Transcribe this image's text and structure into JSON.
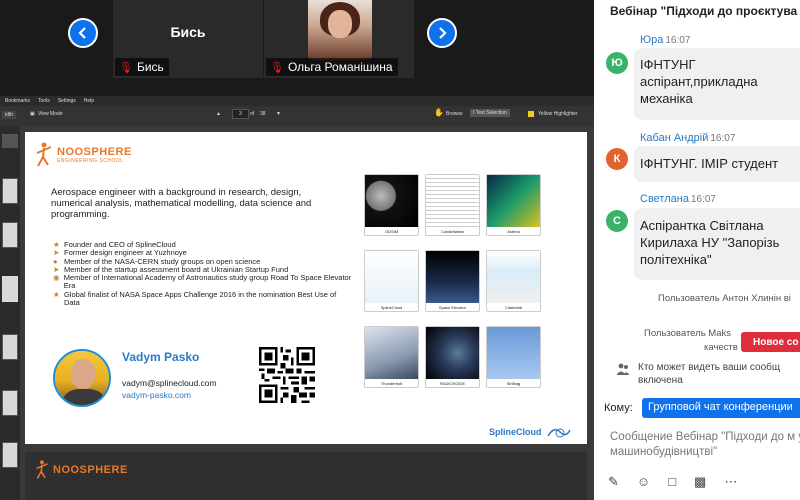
{
  "participants": [
    {
      "name": "Бись",
      "tile_text": "Бись"
    },
    {
      "name": "Ольга Романішина"
    }
  ],
  "pdf_viewer": {
    "menu": [
      "Bookmarks",
      "Tools",
      "Settings",
      "Help"
    ],
    "zoom_label": "idth",
    "view_mode": "View Mode",
    "page_current": "3",
    "page_of": "of",
    "page_total": "38",
    "browse": "Browse",
    "text_selection": "Text Selection",
    "highlighter": "Yellow Highlighter"
  },
  "slide": {
    "logo_name": "NOOSPHERE",
    "logo_sub": "ENGINEERING SCHOOL",
    "description": "Aerospace engineer with a background in research, design, numerical analysis, mathematical modelling, data science and programming.",
    "bullets": [
      "Founder and CEO of SplineCloud",
      "Former design engineer at Yuzhnoye",
      "Member of the NASA-CERN study groups on open science",
      "Member of the startup assessment board at Ukrainian Startup Fund",
      "Member of International Academy of Astronautics study group Road To Space Elevator Era",
      "Global finalist of NASA Space Apps Challenge 2016 in the nomination Best Use of Data"
    ],
    "person_name": "Vadym Pasko",
    "email": "vadym@splinecloud.com",
    "website": "vadym-pasko.com",
    "projects": [
      "ODSIM",
      "Constellation",
      "Asteria",
      "SplineCloud",
      "Space Elevator",
      "Clarkelab",
      "Thunderbolt",
      "RADIOSOIDE",
      "Strilbag"
    ],
    "brand": "SplineCloud"
  },
  "slide2": {
    "logo_name": "NOOSPHERE"
  },
  "chat": {
    "header": "Вебінар \"Підходи до проєктува",
    "messages": [
      {
        "initial": "Ю",
        "name": "Юра",
        "time": "16:07",
        "text": "ІФНТУНГ аспірант,прикладна механіка",
        "color": "#3ab26a"
      },
      {
        "initial": "К",
        "name": "Кабан Андрій",
        "time": "16:07",
        "text": "ІФНТУНГ. ІМІР студент",
        "color": "#e0622d"
      },
      {
        "initial": "С",
        "name": "Светлана",
        "time": "16:07",
        "text": "Аспірантка Світлана Кирилаха НУ \"Запорізь політехніка\"",
        "color": "#3ab26a"
      }
    ],
    "system1": "Пользователь Антон Хлинін ві",
    "system2a": "Пользователь Maks",
    "system2b": "качеств",
    "new_messages_btn": "Новое со",
    "privacy_line1": "Кто может видеть ваши сообщ",
    "privacy_line2": "включена",
    "to_label": "Кому:",
    "to_value": "Групповой чат конференции",
    "compose_placeholder": "Сообщение Вебінар \"Підходи до м у машинобудівництві\""
  }
}
